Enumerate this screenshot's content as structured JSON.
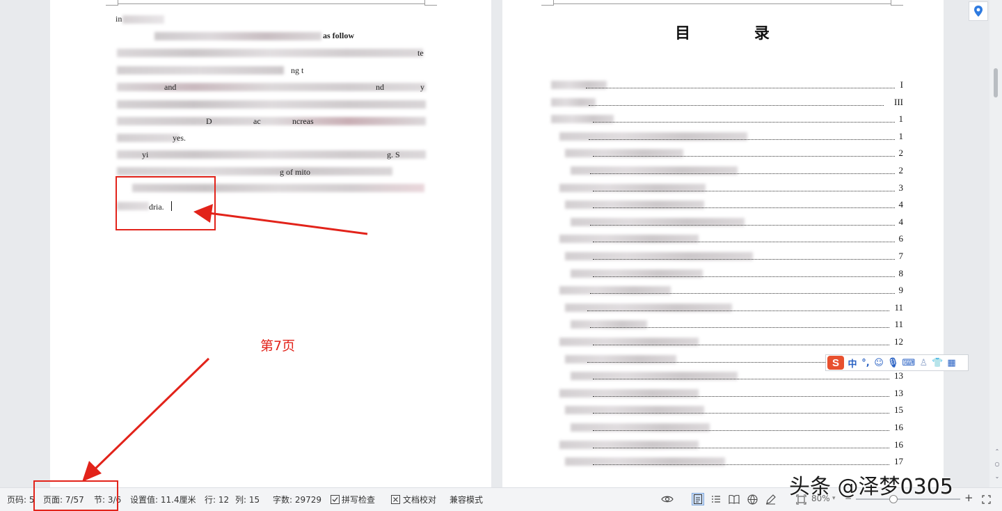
{
  "document": {
    "left_page": {
      "visible_fragments": [
        "in",
        "as follow",
        "te",
        "ng t",
        "and",
        "nd",
        "y",
        "D",
        "ac",
        "ncreas",
        "yes.",
        "yi",
        "g. S",
        "g of mito",
        "dria."
      ]
    },
    "right_page": {
      "toc_title": "目 录",
      "toc_page_numbers": [
        "I",
        "III",
        "1",
        "1",
        "2",
        "2",
        "3",
        "4",
        "4",
        "6",
        "7",
        "8",
        "9",
        "11",
        "11",
        "12",
        "13",
        "13",
        "13",
        "15",
        "16",
        "16",
        "17"
      ]
    }
  },
  "annotation": {
    "label": "第7页",
    "color": "#e2231a"
  },
  "ime_toolbar": {
    "logo": "S",
    "mode": "中",
    "punct": "°,",
    "items": [
      "emoji-icon",
      "microphone-icon",
      "keyboard-icon",
      "user-icon",
      "skin-icon",
      "grid-icon"
    ]
  },
  "statusbar": {
    "page_code": "页码: 5",
    "page": "页面: 7/57",
    "section": "节: 3/6",
    "setting_value": "设置值: 11.4厘米",
    "row": "行: 12",
    "column": "列: 15",
    "word_count": "字数: 29729",
    "spell_check": "拼写检查",
    "doc_proofread": "文档校对",
    "compat_mode": "兼容模式",
    "zoom": "80%",
    "zoom_level": 0.8
  },
  "watermark": "头条 @泽梦0305",
  "colors": {
    "annotation_red": "#e2231a",
    "ime_orange": "#e8512f",
    "ime_blue": "#2a62c4",
    "accent_blue": "#2f7be0"
  }
}
